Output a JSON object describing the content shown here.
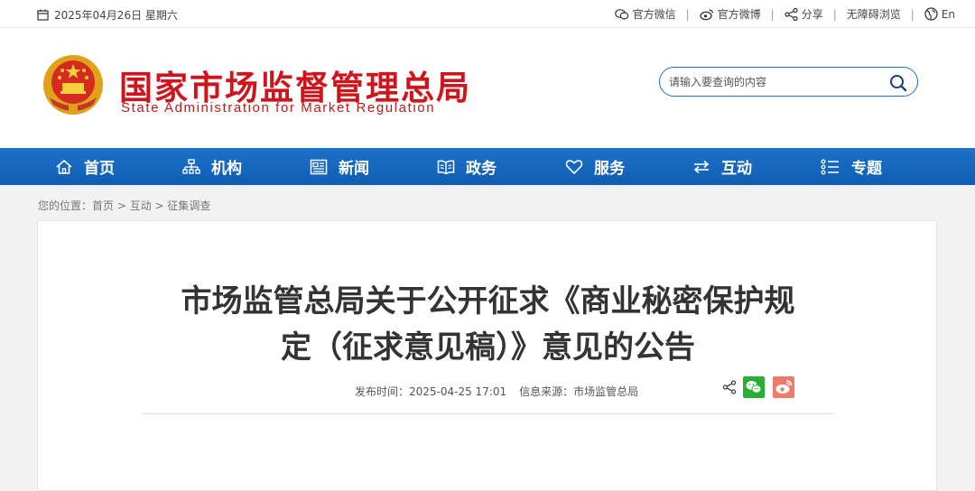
{
  "topbar": {
    "date": "2025年04月26日 星期六",
    "links": [
      {
        "label": "官方微信",
        "icon": "wechat-icon"
      },
      {
        "label": "官方微博",
        "icon": "weibo-icon"
      },
      {
        "label": "分享",
        "icon": "share-icon"
      },
      {
        "label": "无障碍浏览",
        "icon": ""
      },
      {
        "label": "En",
        "icon": "globe-icon"
      }
    ]
  },
  "header": {
    "site_name_cn": "国家市场监督管理总局",
    "site_name_en": "State Administration for Market Regulation",
    "search_placeholder": "请输入要查询的内容"
  },
  "nav": [
    {
      "label": "首页",
      "icon": "home-icon"
    },
    {
      "label": "机构",
      "icon": "org-icon"
    },
    {
      "label": "新闻",
      "icon": "news-icon"
    },
    {
      "label": "政务",
      "icon": "book-icon"
    },
    {
      "label": "服务",
      "icon": "heart-icon"
    },
    {
      "label": "互动",
      "icon": "exchange-icon"
    },
    {
      "label": "专题",
      "icon": "list-icon"
    }
  ],
  "breadcrumb": {
    "prefix": "您的位置：",
    "items": [
      "首页",
      "互动",
      "征集调查"
    ],
    "sep": " > "
  },
  "article": {
    "title_line1": "市场监管总局关于公开征求《商业秘密保护规",
    "title_line2": "定（征求意见稿）》意见的公告",
    "publish_time": "发布时间：2025-04-25 17:01",
    "source": "信息来源：市场监管总局"
  },
  "colors": {
    "brand_red": "#d0141c",
    "nav_blue": "#1565bf",
    "wechat_green": "#2aae35",
    "weibo_red": "#f07a6b"
  }
}
